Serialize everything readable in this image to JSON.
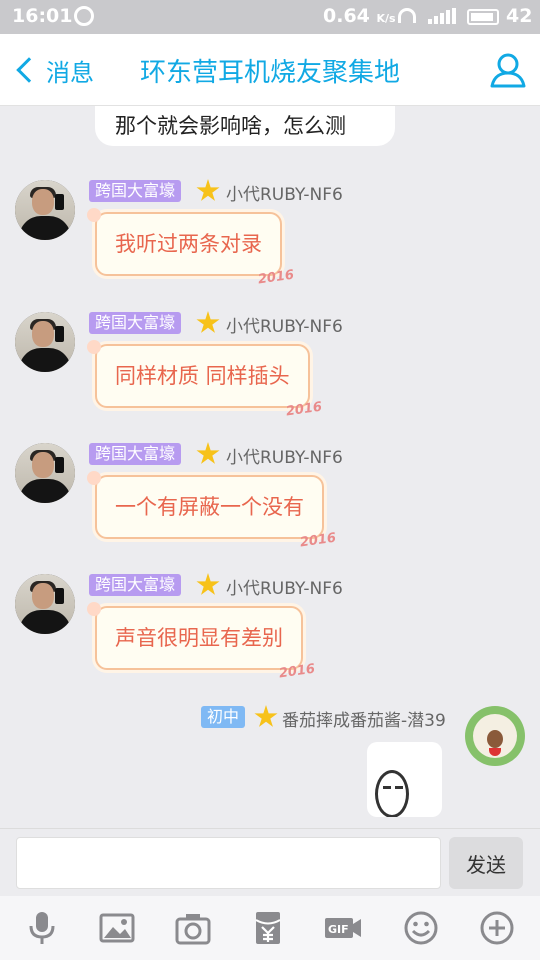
{
  "status_bar": {
    "time": "16:01",
    "network_speed": "0.64",
    "speed_unit": "K/s",
    "battery": "42"
  },
  "header": {
    "back_label": "消息",
    "title": "环东营耳机烧友聚集地"
  },
  "chat": {
    "previous_message": "那个就会影响啥，怎么测",
    "messages": [
      {
        "badge": "跨国大富壕",
        "sender": "小代RUBY-NF6",
        "text": "我听过两条对录",
        "deco": "2016"
      },
      {
        "badge": "跨国大富壕",
        "sender": "小代RUBY-NF6",
        "text": "同样材质 同样插头",
        "deco": "2016"
      },
      {
        "badge": "跨国大富壕",
        "sender": "小代RUBY-NF6",
        "text": "一个有屏蔽一个没有",
        "deco": "2016"
      },
      {
        "badge": "跨国大富壕",
        "sender": "小代RUBY-NF6",
        "text": "声音很明显有差别",
        "deco": "2016"
      }
    ],
    "self": {
      "badge": "初中",
      "sender": "番茄摔成番茄酱-潜39"
    }
  },
  "input": {
    "value": "",
    "send_label": "发送"
  },
  "toolbar": {
    "icons": [
      "microphone-icon",
      "image-icon",
      "camera-icon",
      "red-packet-icon",
      "gif-icon",
      "emoji-icon",
      "plus-icon"
    ]
  },
  "colors": {
    "accent": "#11a9e4",
    "bubble_text": "#e8664e",
    "badge_purple": "#b79bf0",
    "badge_blue": "#7fb9f4"
  }
}
